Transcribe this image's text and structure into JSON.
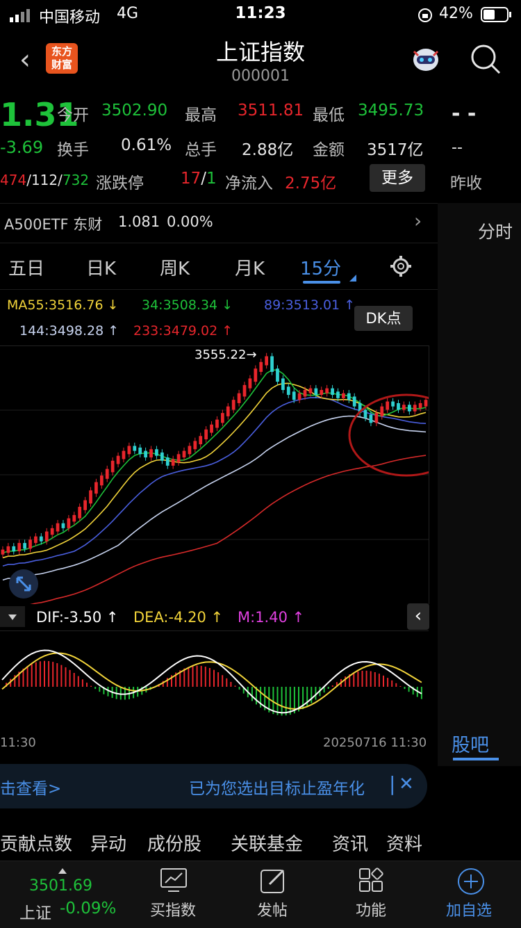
{
  "status": {
    "carrier": "中国移动",
    "network": "4G",
    "time": "11:23",
    "battery": "42%"
  },
  "header": {
    "title": "上证指数",
    "code": "000001",
    "logo_line1": "东方",
    "logo_line2": "财富"
  },
  "quote": {
    "price": "1.31",
    "change": "-3.69",
    "open_label": "今开",
    "open": "3502.90",
    "high_label": "最高",
    "high": "3511.81",
    "low_label": "最低",
    "low": "3495.73",
    "turnover_label": "换手",
    "turnover": "0.61%",
    "volume_label": "总手",
    "volume": "2.88亿",
    "amount_label": "金额",
    "amount": "3517亿",
    "breadth_up": "474",
    "breadth_flat": "112",
    "breadth_down": "732",
    "limit_label": "涨跌停",
    "limit_up": "17",
    "limit_down": "1",
    "netflow_label": "净流入",
    "netflow": "2.75亿",
    "more_button": "更多",
    "right_dash1": "- -",
    "right_dash2": "--",
    "prev_close_label": "昨收"
  },
  "etf": {
    "name": "A500ETF 东财",
    "price": "1.081",
    "change": "0.00%"
  },
  "right_panel": {
    "tab1": "分时",
    "tab2": "股吧"
  },
  "tabs": [
    "五日",
    "日K",
    "周K",
    "月K",
    "15分"
  ],
  "ma": {
    "ma55": "MA55:3516.76 ↓",
    "ma34": "34:3508.34 ↓",
    "ma89": "89:3513.01 ↑",
    "ma144": "144:3498.28 ↑",
    "ma233": "233:3479.02 ↑"
  },
  "dk_button": "DK点",
  "chart_data": {
    "type": "candlestick",
    "max_label": "3555.22",
    "start_time": "11:30",
    "end_time": "20250716 11:30",
    "macd": {
      "dif": "DIF:-3.50 ↑",
      "dea": "DEA:-4.20 ↑",
      "m": "M:1.40 ↑"
    },
    "closes": [
      3320,
      3324,
      3322,
      3328,
      3325,
      3332,
      3336,
      3334,
      3342,
      3346,
      3352,
      3350,
      3358,
      3362,
      3372,
      3380,
      3392,
      3402,
      3410,
      3418,
      3428,
      3434,
      3440,
      3446,
      3444,
      3440,
      3436,
      3442,
      3438,
      3432,
      3426,
      3430,
      3436,
      3440,
      3446,
      3452,
      3458,
      3466,
      3472,
      3478,
      3486,
      3494,
      3502,
      3510,
      3520,
      3528,
      3540,
      3548,
      3555,
      3540,
      3528,
      3518,
      3512,
      3506,
      3510,
      3514,
      3516,
      3512,
      3514,
      3516,
      3512,
      3508,
      3510,
      3506,
      3498,
      3490,
      3484,
      3478,
      3486,
      3494,
      3500,
      3498,
      3494,
      3496,
      3492,
      3496,
      3498,
      3502
    ],
    "ma_colors": {
      "ma55": "#f2d43a",
      "ma34": "#1ec23a",
      "ma89": "#4a5fe0",
      "ma144": "#c8d4f0",
      "ma233": "#d82a2a"
    }
  },
  "banner": {
    "left_text": "击查看>",
    "right_text": "已为您选出目标止盈年化"
  },
  "bottom_tabs": [
    "贡献点数",
    "异动",
    "成份股",
    "关联基金",
    "资讯",
    "资料"
  ],
  "nav": {
    "index_value": "3501.69",
    "index_name": "上证",
    "index_change": "-0.09%",
    "buy_index": "买指数",
    "post": "发帖",
    "functions": "功能",
    "add_fav": "加自选"
  }
}
